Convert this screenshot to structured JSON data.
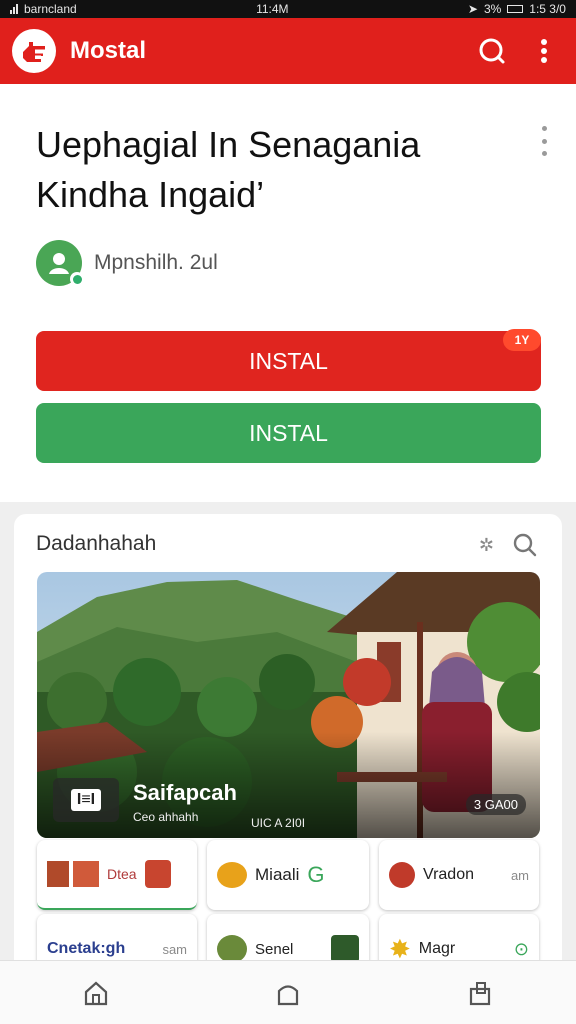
{
  "status_bar": {
    "carrier": "barncland",
    "time": "11:4M",
    "battery": "3%",
    "right_time": "1:5 3/0"
  },
  "app_bar": {
    "title": "Mostal",
    "icons": [
      "logo-icon",
      "search-icon",
      "more-vert-icon"
    ],
    "color": "#e0201c"
  },
  "article": {
    "headline_line1": "Uephagial In Senagania",
    "headline_line2": "Kindha Ingaid’",
    "author": "Mpnshilh. 2ul"
  },
  "actions": {
    "install_red": "INSTAL",
    "install_red_badge": "1Y",
    "install_green": "INSTAL"
  },
  "section": {
    "title": "Dadanhahah",
    "hero": {
      "chip": "I≡I",
      "title": "Saifapcah",
      "subtitle": "Ceo ahhahh",
      "meta": "UIC A 2I0I",
      "count": "3 GA00"
    },
    "tiles_row1": [
      {
        "label": "Dtea",
        "small": ""
      },
      {
        "label": "Miaali",
        "small": ""
      },
      {
        "label": "Vradon",
        "small": "am"
      }
    ],
    "tiles_row2": [
      {
        "label": "Cnetak:gh",
        "small": "sam"
      },
      {
        "label": "Senel",
        "small": ""
      },
      {
        "label": "Magr",
        "small": ""
      }
    ]
  },
  "bottom_nav": [
    "home-icon",
    "tab-icon",
    "share-icon"
  ],
  "colors": {
    "accent_red": "#e0201c",
    "accent_green": "#3aa65a"
  }
}
